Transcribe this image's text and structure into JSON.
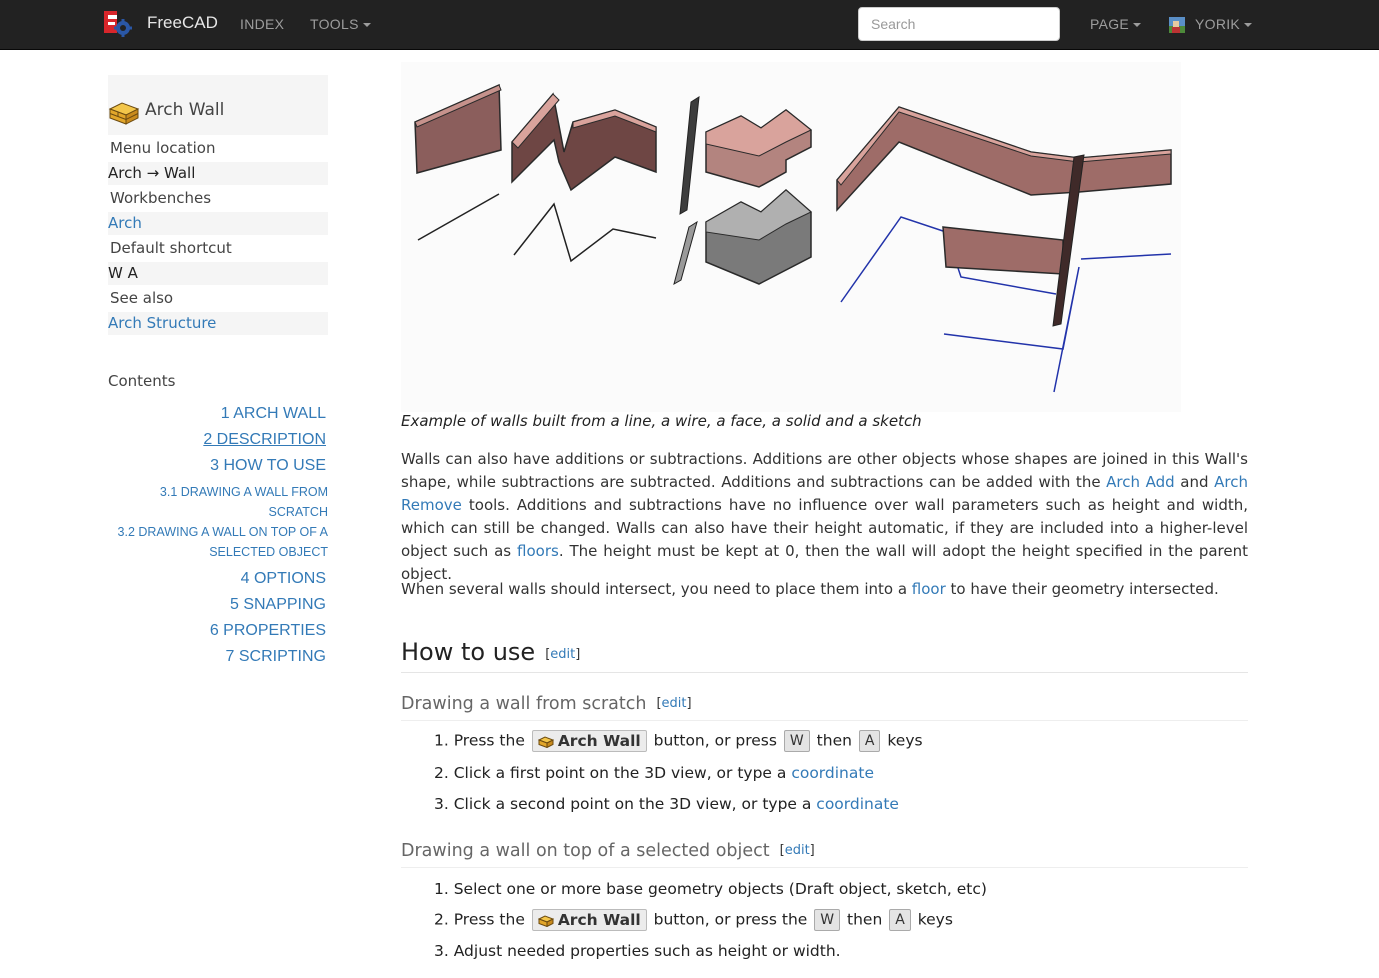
{
  "navbar": {
    "brand": "FreeCAD",
    "index_label": "INDEX",
    "tools_label": "TOOLS",
    "search_placeholder": "Search",
    "page_label": "PAGE",
    "user_label": "YORIK"
  },
  "sidebar": {
    "title": "Arch Wall",
    "menu_location_label": "Menu location",
    "menu_location_value": "Arch → Wall",
    "workbenches_label": "Workbenches",
    "workbenches_value": "Arch",
    "shortcut_label": "Default shortcut",
    "shortcut_value": "W A",
    "see_also_label": "See also",
    "see_also_value": "Arch Structure"
  },
  "toc": {
    "title": "Contents",
    "items": [
      "1 ARCH WALL",
      "2 DESCRIPTION",
      "3 HOW TO USE",
      "3.1 DRAWING A WALL FROM",
      "SCRATCH",
      "3.2 DRAWING A WALL ON TOP OF A",
      "SELECTED OBJECT",
      "4 OPTIONS",
      "5 SNAPPING",
      "6 PROPERTIES",
      "7 SCRIPTING"
    ]
  },
  "main": {
    "caption": "Example of walls built from a line, a wire, a face, a solid and a sketch",
    "p1": {
      "text_a": "Walls can also have additions or subtractions. Additions are other objects whose shapes are joined in this Wall's shape, while subtractions are subtracted. Additions and subtractions can be added with the ",
      "link_add": "Arch Add",
      "text_and": " and ",
      "link_remove": "Arch Remove",
      "text_b": " tools. Additions and subtractions have no influence over wall parameters such as height and width, which can still be changed. Walls can also have their height automatic, if they are included into a higher-level object such as ",
      "link_floors": "floors",
      "text_c": ". The height must be kept at 0, then the wall will adopt the height specified in the parent object."
    },
    "p2": {
      "text_a": "When several walls should intersect, you need to place them into a ",
      "link_floor": "floor",
      "text_b": " to have their geometry intersected."
    },
    "how_to_use": "How to use",
    "edit": "edit",
    "sub1": {
      "title": "Drawing a wall from scratch",
      "step1_a": "1. Press the ",
      "button": "Arch Wall",
      "step1_b": " button, or press ",
      "key_w": "W",
      "then": " then ",
      "key_a": "A",
      "keys": " keys",
      "step2": "2. Click a first point on the 3D view, or type a ",
      "step3": "3. Click a second point on the 3D view, or type a ",
      "coordinate": "coordinate"
    },
    "sub2": {
      "title": "Drawing a wall on top of a selected object",
      "step1": "1. Select one or more base geometry objects (Draft object, sketch, etc)",
      "step2_a": "2. Press the ",
      "button": "Arch Wall",
      "step2_b": " button, or press the ",
      "key_w": "W",
      "then": " then ",
      "key_a": "A",
      "keys": " keys",
      "step3": "3. Adjust needed properties such as height or width."
    }
  }
}
